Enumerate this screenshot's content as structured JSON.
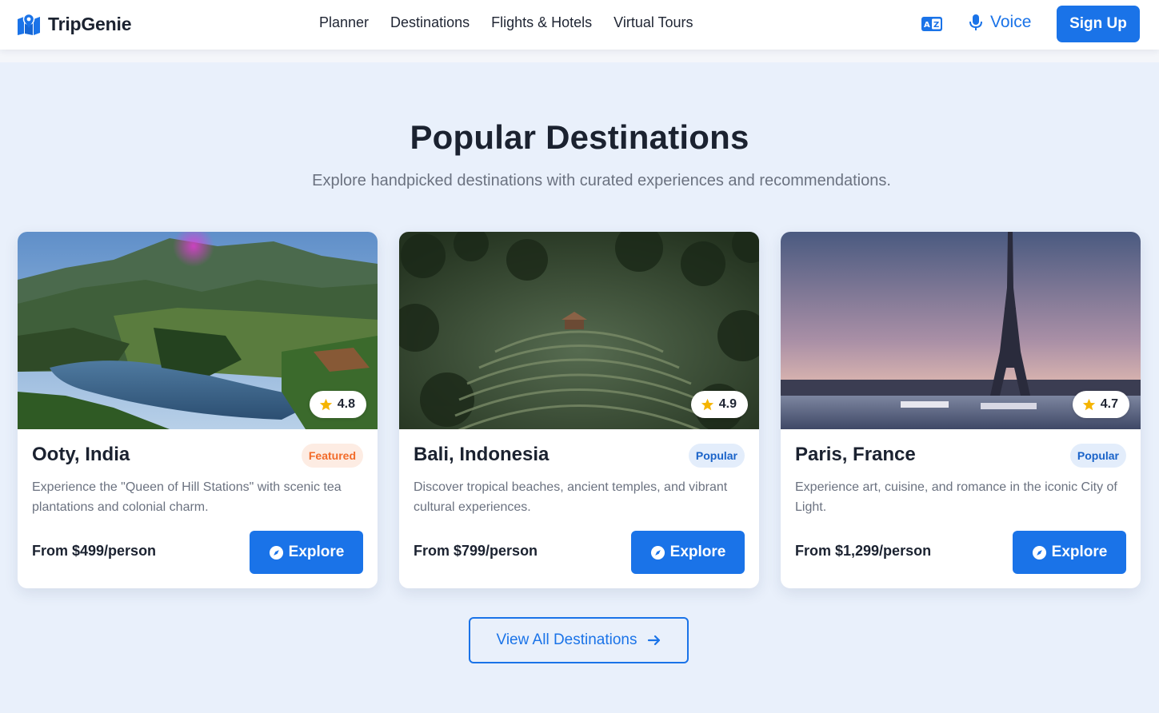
{
  "header": {
    "brand": "TripGenie",
    "nav": [
      "Planner",
      "Destinations",
      "Flights & Hotels",
      "Virtual Tours"
    ],
    "voice_label": "Voice",
    "signup_label": "Sign Up",
    "accent_color": "#1a73e8"
  },
  "section": {
    "title": "Popular Destinations",
    "subtitle": "Explore handpicked destinations with curated experiences and recommendations."
  },
  "cards": [
    {
      "title": "Ooty, India",
      "badge": "Featured",
      "rating": "4.8",
      "description": "Experience the \"Queen of Hill Stations\" with scenic tea plantations and colonial charm.",
      "price": "From $499/person",
      "button": "Explore"
    },
    {
      "title": "Bali, Indonesia",
      "badge": "Popular",
      "rating": "4.9",
      "description": "Discover tropical beaches, ancient temples, and vibrant cultural experiences.",
      "price": "From $799/person",
      "button": "Explore"
    },
    {
      "title": "Paris, France",
      "badge": "Popular",
      "rating": "4.7",
      "description": "Experience art, cuisine, and romance in the iconic City of Light.",
      "price": "From $1,299/person",
      "button": "Explore"
    }
  ],
  "view_all_label": "View All Destinations",
  "icons": {
    "logo": "map-pin-icon",
    "translate": "translate-icon",
    "voice": "microphone-icon",
    "rating": "star-icon",
    "explore": "compass-icon",
    "view_all": "arrow-right-icon"
  }
}
